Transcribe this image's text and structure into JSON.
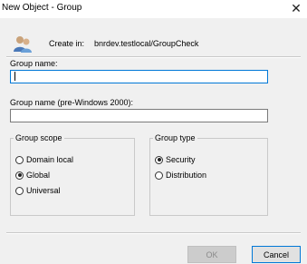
{
  "window": {
    "title": "New Object - Group",
    "close_glyph": "✕"
  },
  "header": {
    "created_in_label": "Create in:",
    "created_in_path": "bnrdev.testlocal/GroupCheck",
    "icon": "users-group-icon"
  },
  "form": {
    "group_name_label": "Group name:",
    "group_name_value": "",
    "pre2000_label": "Group name (pre-Windows 2000):",
    "pre2000_value": ""
  },
  "scope": {
    "legend": "Group scope",
    "options": [
      {
        "label": "Domain local",
        "checked": false
      },
      {
        "label": "Global",
        "checked": true
      },
      {
        "label": "Universal",
        "checked": false
      }
    ]
  },
  "type": {
    "legend": "Group type",
    "options": [
      {
        "label": "Security",
        "checked": true
      },
      {
        "label": "Distribution",
        "checked": false
      }
    ]
  },
  "buttons": {
    "ok": "OK",
    "cancel": "Cancel"
  },
  "colors": {
    "focus": "#0078d7",
    "panel": "#f0f0f0"
  }
}
